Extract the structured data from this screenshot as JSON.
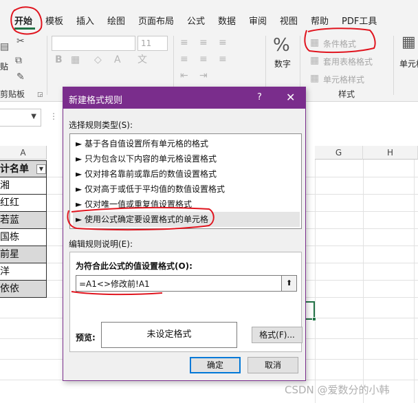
{
  "menu": {
    "tabs": [
      "开始",
      "模板",
      "插入",
      "绘图",
      "页面布局",
      "公式",
      "数据",
      "审阅",
      "视图",
      "帮助",
      "PDF工具"
    ],
    "active": "开始"
  },
  "ribbon": {
    "clipboard": {
      "paste_label": "贴",
      "group_label": "剪贴板"
    },
    "font": {
      "size_value": "11",
      "bold_label": "B"
    },
    "number": {
      "label": "数字",
      "symbol": "%"
    },
    "styles": {
      "conditional_format": "条件格式",
      "table_format": "套用表格格式",
      "cell_styles": "单元格样式",
      "group_label": "样式"
    },
    "cells": {
      "label": "单元格"
    }
  },
  "grid": {
    "columns": [
      "A",
      "G",
      "H"
    ],
    "cells": [
      "计名单",
      "湘",
      "红红",
      "若蓝",
      "国栋",
      "前星",
      "洋",
      "依依"
    ]
  },
  "dialog": {
    "title": "新建格式规则",
    "help": "?",
    "close": "✕",
    "rule_type_label": "选择规则类型(S):",
    "rule_types": [
      "► 基于各自值设置所有单元格的格式",
      "► 只为包含以下内容的单元格设置格式",
      "► 仅对排名靠前或靠后的数值设置格式",
      "► 仅对高于或低于平均值的数值设置格式",
      "► 仅对唯一值或重复值设置格式",
      "► 使用公式确定要设置格式的单元格"
    ],
    "selected_index": 5,
    "edit_label": "编辑规则说明(E):",
    "formula_heading": "为符合此公式的值设置格式(O):",
    "formula_value": "=A1<>修改前!A1",
    "collapse_icon": "⬆",
    "preview_label": "预览:",
    "preview_text": "未设定格式",
    "format_button": "格式(F)...",
    "ok_button": "确定",
    "cancel_button": "取消"
  },
  "watermark": "CSDN @爱数分的小韩",
  "colors": {
    "dialog_title": "#7a2d8c",
    "accent_green": "#217346",
    "annotation_red": "#e0141e",
    "ok_border": "#0078d7"
  }
}
